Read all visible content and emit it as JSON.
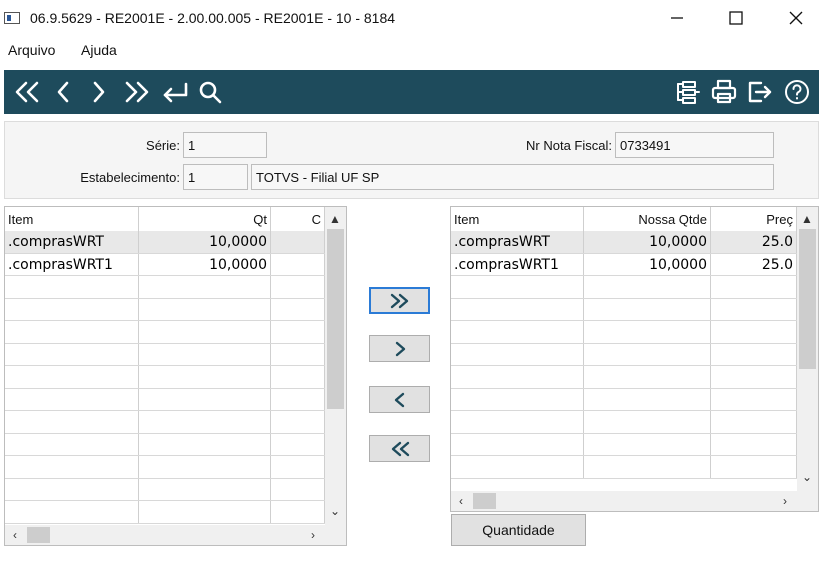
{
  "window": {
    "title": "06.9.5629 - RE2001E - 2.00.00.005 - RE2001E - 10 - 8184",
    "controls": [
      "minimize-icon",
      "maximize-icon",
      "close-icon"
    ]
  },
  "menu": {
    "items": [
      "Arquivo",
      "Ajuda"
    ]
  },
  "toolbar": {
    "accent": "#1e4b5c",
    "left_icons": [
      "first-record-icon",
      "previous-record-icon",
      "next-record-icon",
      "last-record-icon",
      "goto-return-icon",
      "search-icon"
    ],
    "right_icons": [
      "navigation-tree-icon",
      "print-icon",
      "exit-icon",
      "help-icon"
    ]
  },
  "header": {
    "serie_label": "Série:",
    "serie_value": "1",
    "nota_label": "Nr Nota Fiscal:",
    "nota_value": "0733491",
    "estab_label": "Estabelecimento:",
    "estab_code": "1",
    "estab_name": "TOTVS - Filial UF SP"
  },
  "left_grid": {
    "columns": [
      "Item",
      "Qt",
      "C"
    ],
    "rows": [
      [
        ".comprasWRT",
        "10,0000",
        ""
      ],
      [
        ".comprasWRT1",
        "10,0000",
        ""
      ]
    ]
  },
  "right_grid": {
    "columns": [
      "Item",
      "Nossa Qtde",
      "Preç"
    ],
    "rows": [
      [
        ".comprasWRT",
        "10,0000",
        "25.0"
      ],
      [
        ".comprasWRT1",
        "10,0000",
        "25.0"
      ]
    ]
  },
  "transfer_buttons": [
    "add-all-icon",
    "add-selected-icon",
    "remove-selected-icon",
    "remove-all-icon"
  ],
  "quantity_button": "Quantidade"
}
